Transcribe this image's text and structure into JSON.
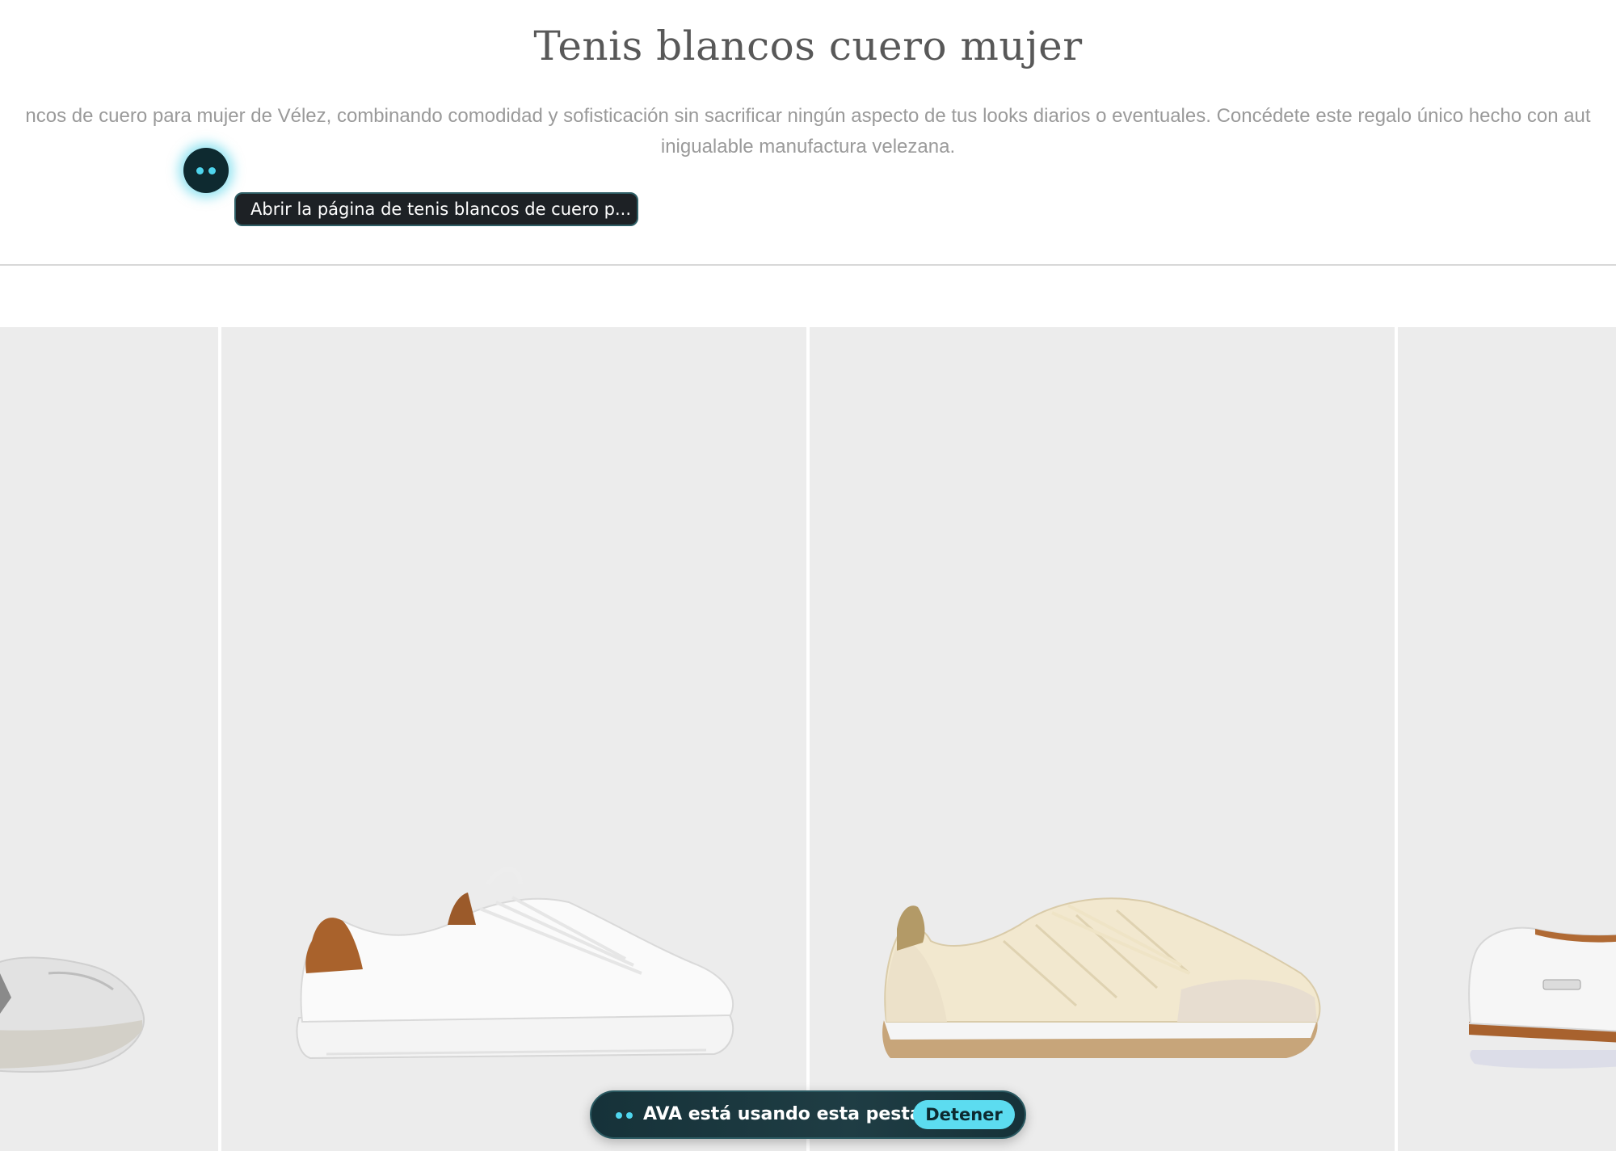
{
  "page": {
    "title": "Tenis blancos cuero mujer",
    "description_line1": "ncos de cuero para mujer de Vélez, combinando comodidad y sofisticación sin sacrificar ningún aspecto de tus looks diarios o eventuales. Concédete este regalo único hecho con aut",
    "description_line2": "inigualable manufactura velezana."
  },
  "agent": {
    "tooltip": "Abrir la página de tenis blancos de cuero p...",
    "status_text": "AVA está usando esta pestaña",
    "stop_label": "Detener",
    "accent_color": "#5cdcf0"
  },
  "products": [
    {
      "image": "white-silver-distressed-sneaker"
    },
    {
      "image": "white-leather-sneaker-brown-heel"
    },
    {
      "image": "cream-quilted-running-sneaker"
    },
    {
      "image": "white-leather-sneaker-brown-stripe"
    }
  ]
}
